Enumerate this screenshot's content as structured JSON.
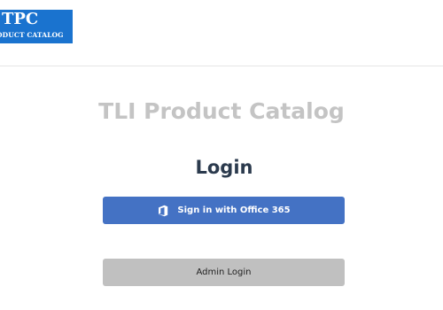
{
  "logo": {
    "title": "TPC",
    "subtitle": "ODUCT CATALOG"
  },
  "main": {
    "app_title": "TLI Product Catalog",
    "login_heading": "Login",
    "office_button_label": "Sign in with Office 365",
    "admin_button_label": "Admin Login"
  },
  "colors": {
    "logo_background": "#1a73cf",
    "office_button": "#4472c4",
    "admin_button": "#c0c0c0",
    "title_gray": "#c4c4c4",
    "heading_dark": "#2b3a4d"
  },
  "icons": {
    "office_button_icon": "office-365-icon"
  }
}
